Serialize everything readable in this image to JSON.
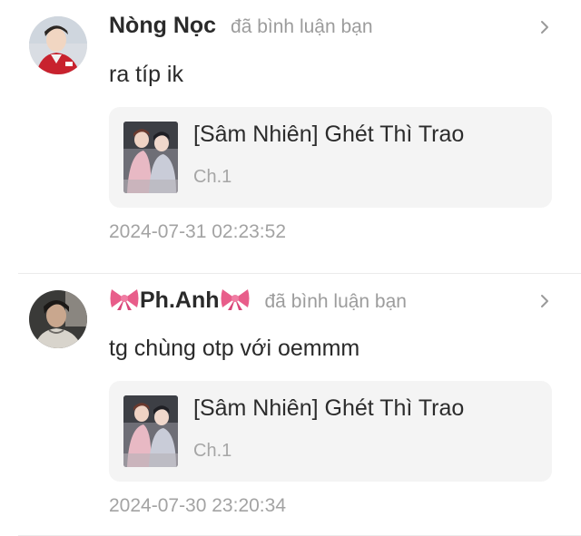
{
  "notifications": [
    {
      "user": "Nòng Nọc",
      "action": "đã bình luận bạn",
      "comment": "ra típ ik",
      "story_title": "[Sâm Nhiên] Ghét Thì Trao",
      "chapter": "Ch.1",
      "timestamp": "2024-07-31 02:23:52"
    },
    {
      "user": "Ph.Anh",
      "action": "đã bình luận bạn",
      "comment": "tg chùng otp với oemmm",
      "story_title": "[Sâm Nhiên] Ghét Thì Trao",
      "chapter": "Ch.1",
      "timestamp": "2024-07-30 23:20:34"
    }
  ],
  "icons": {
    "chevron": "chevron-right-icon",
    "bow": "ribbon-bow-emoji"
  },
  "colors": {
    "username": "#2a2a2a",
    "muted": "#9c9c9c",
    "card_bg": "#f4f4f4",
    "bow": "#e85d8a"
  }
}
